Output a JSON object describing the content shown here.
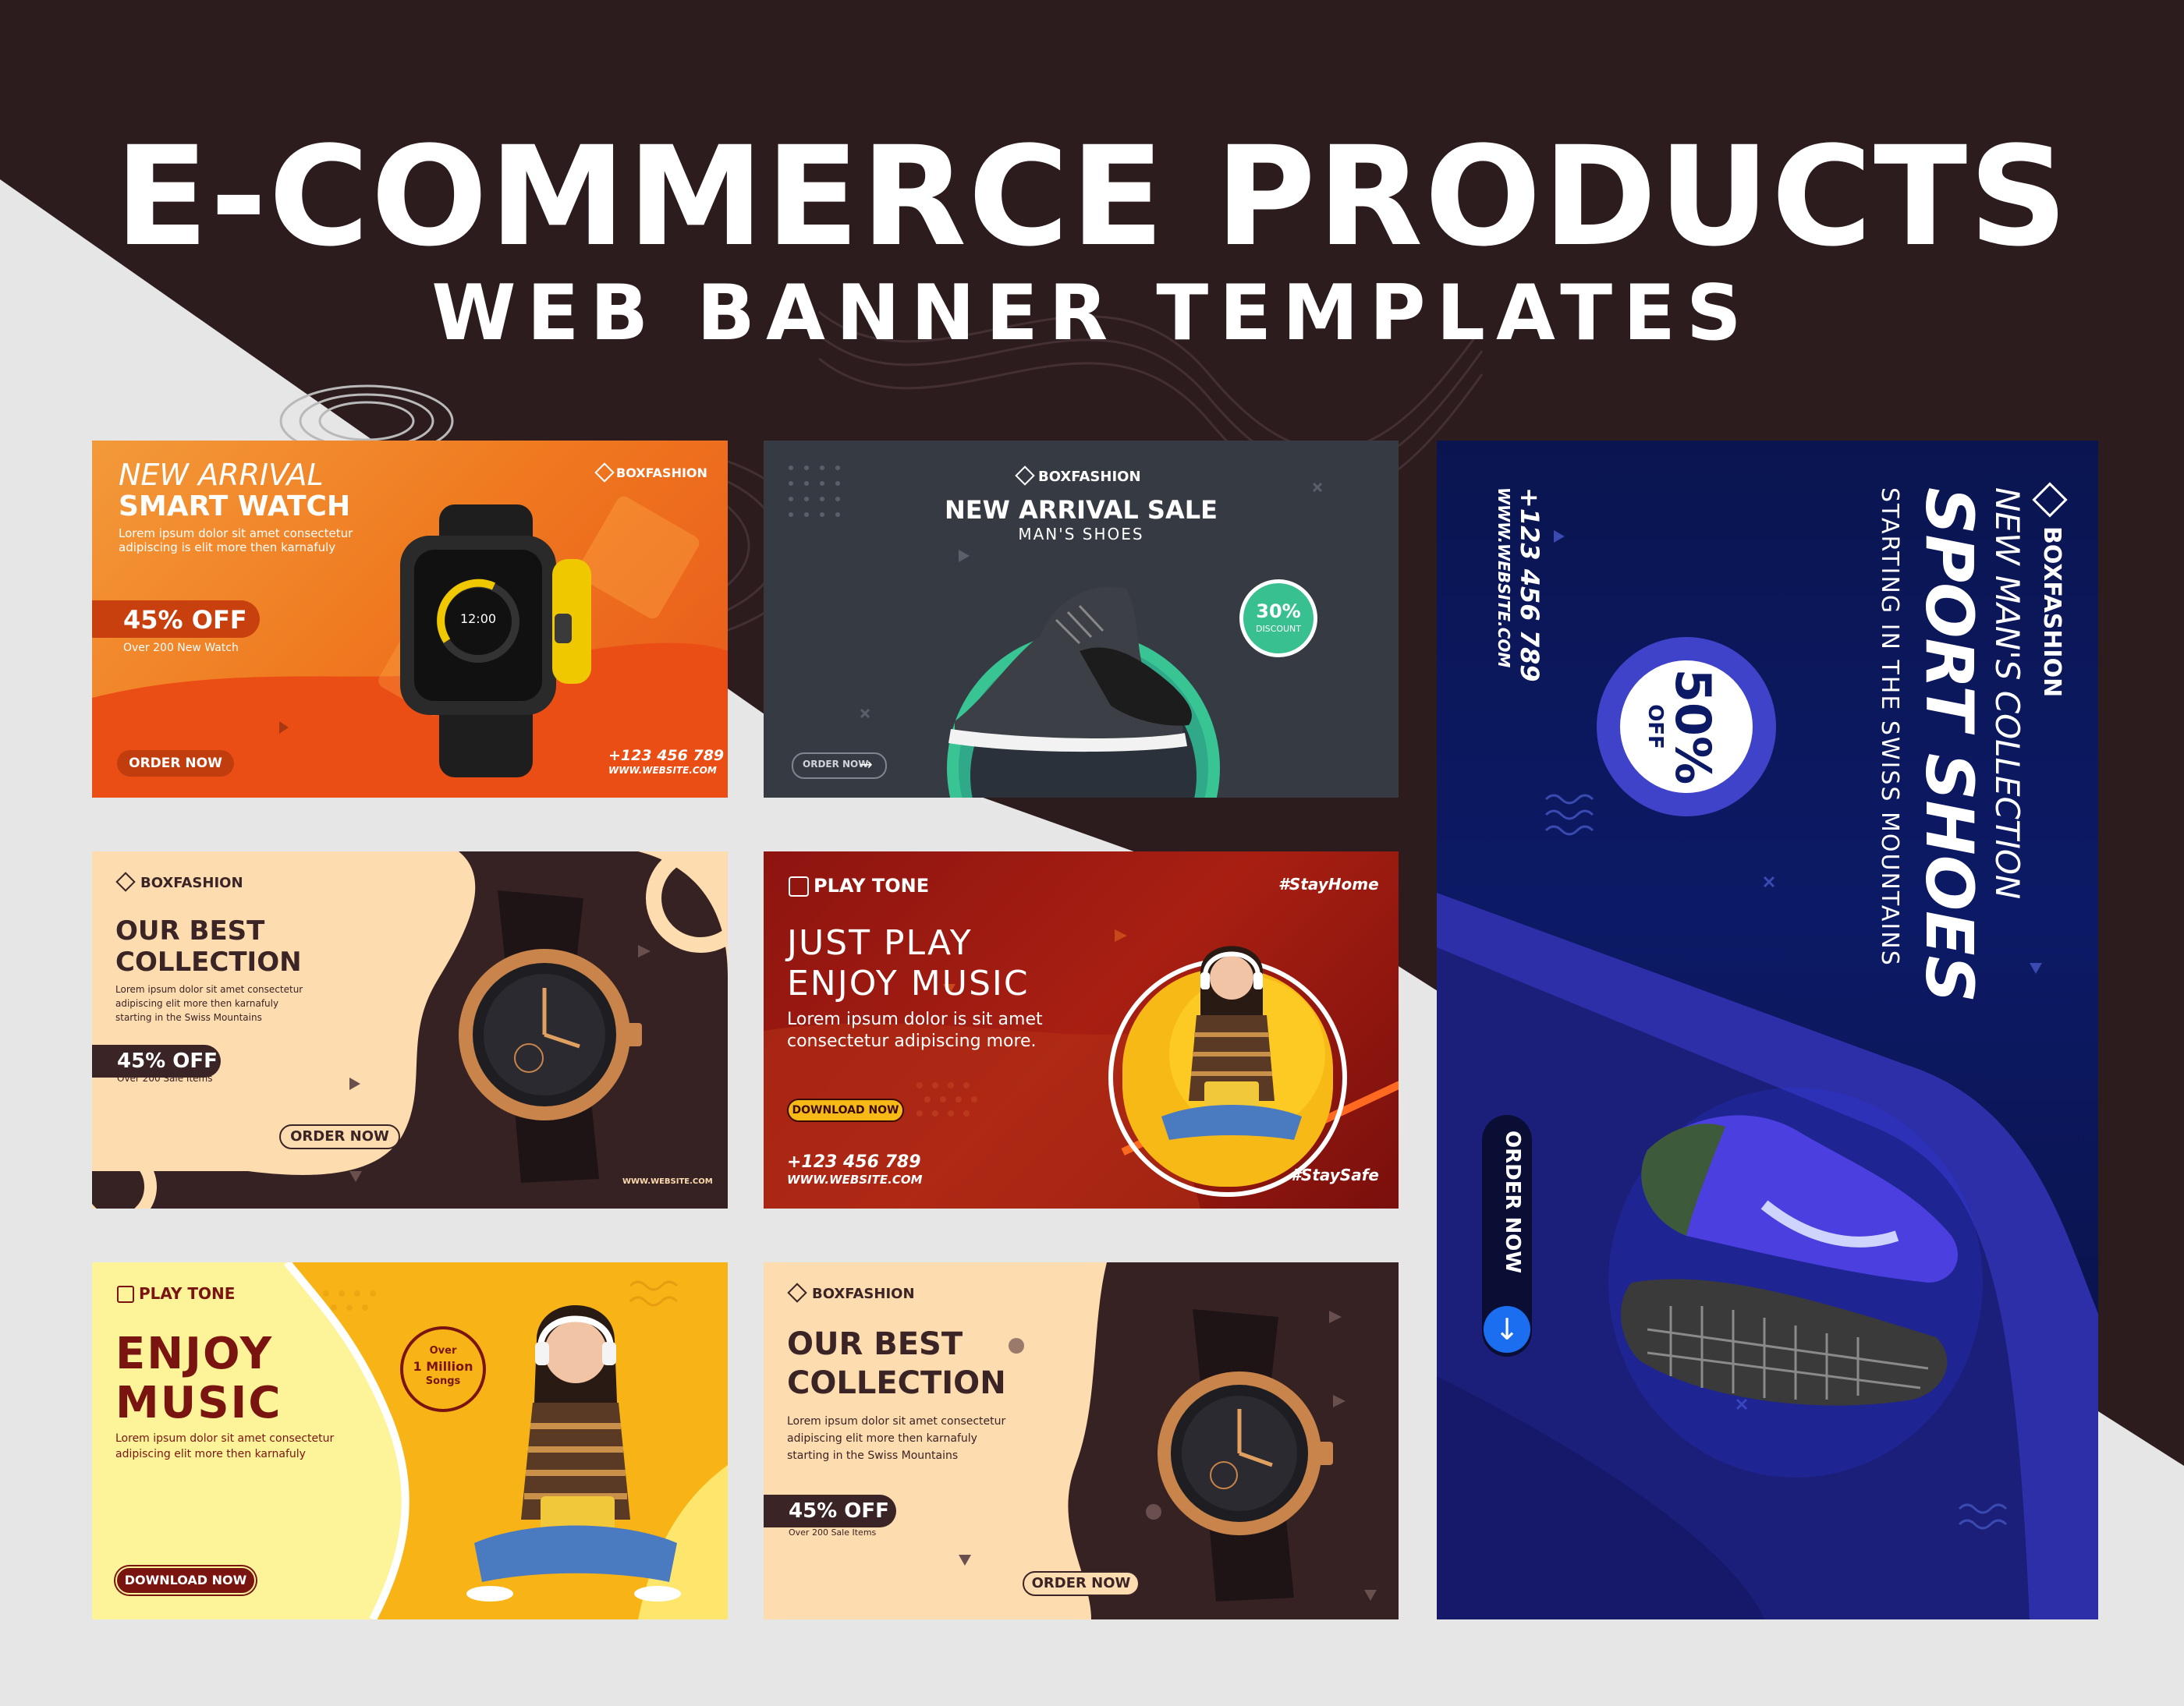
{
  "heading": {
    "title": "E-COMMERCE PRODUCTS",
    "subtitle": "WEB BANNER TEMPLATES"
  },
  "banners": {
    "watch_orange": {
      "line1": "NEW ARRIVAL",
      "line2": "SMART WATCH",
      "desc1": "Lorem ipsum dolor sit amet consectetur",
      "desc2": "adipiscing is elit more then karnafuly",
      "brand": "BOXFASHION",
      "discount": "45% OFF",
      "discount_sub": "Over 200 New Watch",
      "button": "ORDER NOW",
      "phone": "+123 456 789",
      "website": "WWW.WEBSITE.COM",
      "screen_time": "12:00"
    },
    "shoes_dark": {
      "brand": "BOXFASHION",
      "title": "NEW ARRIVAL SALE",
      "subtitle": "MAN'S SHOES",
      "badge_value": "30%",
      "badge_label": "DISCOUNT",
      "button": "ORDER NOW"
    },
    "sport_shoes": {
      "brand": "BOXFASHION",
      "line1": "NEW MAN'S COLLECTION",
      "line2": "SPORT SHOES",
      "line3": "STARTING IN THE SWISS MOUNTAINS",
      "phone": "+123 456 789",
      "website": "WWW.WEBSITE.COM",
      "badge_value": "50%",
      "badge_label": "OFF",
      "button": "ORDER NOW"
    },
    "collection_1": {
      "brand": "BOXFASHION",
      "line1": "OUR BEST",
      "line2": "COLLECTION",
      "desc1": "Lorem ipsum dolor sit amet consectetur",
      "desc2": "adipiscing elit more then karnafuly",
      "desc3": "starting in the Swiss Mountains",
      "discount": "45% OFF",
      "discount_sub": "Over 200 Sale Items",
      "button": "ORDER NOW",
      "website": "WWW.WEBSITE.COM"
    },
    "music_red": {
      "brand": "PLAY TONE",
      "hashtag1": "#StayHome",
      "hashtag2": "#StaySafe",
      "line1": "JUST PLAY",
      "line2": "ENJOY MUSIC",
      "desc1": "Lorem ipsum dolor is sit amet",
      "desc2": "consectetur adipiscing more.",
      "button": "DOWNLOAD NOW",
      "phone": "+123 456 789",
      "website": "WWW.WEBSITE.COM"
    },
    "music_yellow": {
      "brand": "PLAY TONE",
      "line1": "ENJOY",
      "line2": "MUSIC",
      "desc1": "Lorem ipsum dolor sit amet consectetur",
      "desc2": "adipiscing elit more then karnafuly",
      "badge1": "Over",
      "badge2": "1 Million",
      "badge3": "Songs",
      "button": "DOWNLOAD NOW"
    },
    "collection_2": {
      "brand": "BOXFASHION",
      "line1": "OUR BEST",
      "line2": "COLLECTION",
      "desc1": "Lorem ipsum dolor sit amet consectetur",
      "desc2": "adipiscing elit more then karnafuly",
      "desc3": "starting in the Swiss Mountains",
      "discount": "45% OFF",
      "discount_sub": "Over 200 Sale Items",
      "button": "ORDER NOW"
    }
  }
}
